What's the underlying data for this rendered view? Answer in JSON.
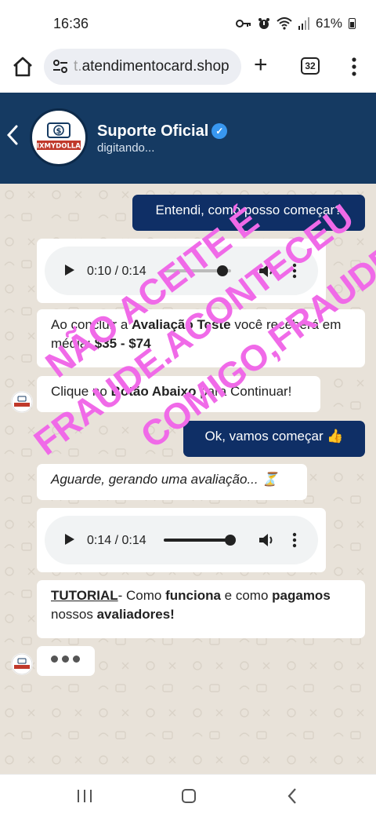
{
  "status_bar": {
    "time": "16:36",
    "battery": "61%",
    "icons": [
      "key-icon",
      "alarm-icon",
      "wifi-icon",
      "signal-icon",
      "battery-icon"
    ]
  },
  "browser": {
    "url_prefix": "t.",
    "url_main": "atendimentocard.shop",
    "tab_count": "32",
    "icons": [
      "home-icon",
      "site-settings-icon",
      "new-tab-icon",
      "tabs-icon",
      "more-menu-icon"
    ]
  },
  "chat_header": {
    "contact_name": "Suporte Oficial",
    "status": "digitando...",
    "avatar_text": "PIXMYDOLLAR",
    "avatar_symbol": "$",
    "verified_symbol": "✓"
  },
  "colors": {
    "header_bg": "#153a62",
    "outgoing_bubble": "#0f2f66",
    "chat_bg": "#e8e2d9",
    "watermark": "#f06ae8"
  },
  "messages": {
    "m1": {
      "text": "Entendi, como posso começar?"
    },
    "audio1": {
      "time": "0:10 / 0:14"
    },
    "m2": {
      "p1": "Ao concluir a ",
      "b1": "Avaliação Teste",
      "p2": " você receberá em média: ",
      "b2": "$35 - $74"
    },
    "m3": {
      "p1": "Clique no ",
      "b1": "Botão Abaixo",
      "p2": " para Continuar!"
    },
    "m4": {
      "text": "Ok, vamos começar 👍"
    },
    "m5": {
      "text": "Aguarde, gerando uma avaliação... ⏳"
    },
    "audio2": {
      "time": "0:14 / 0:14"
    },
    "m6": {
      "u1": "TUTORIAL",
      "p1": "- Como ",
      "b1": "funciona",
      "p2": " e como ",
      "b2": "pagamos",
      "p3": " nossos ",
      "b3": "avaliadores!"
    }
  },
  "watermark": {
    "line1": "NÃO ACEITE É",
    "line2": "FRAUDE.ACONTECEU",
    "line3": "COMIGO,FRAUDE"
  }
}
